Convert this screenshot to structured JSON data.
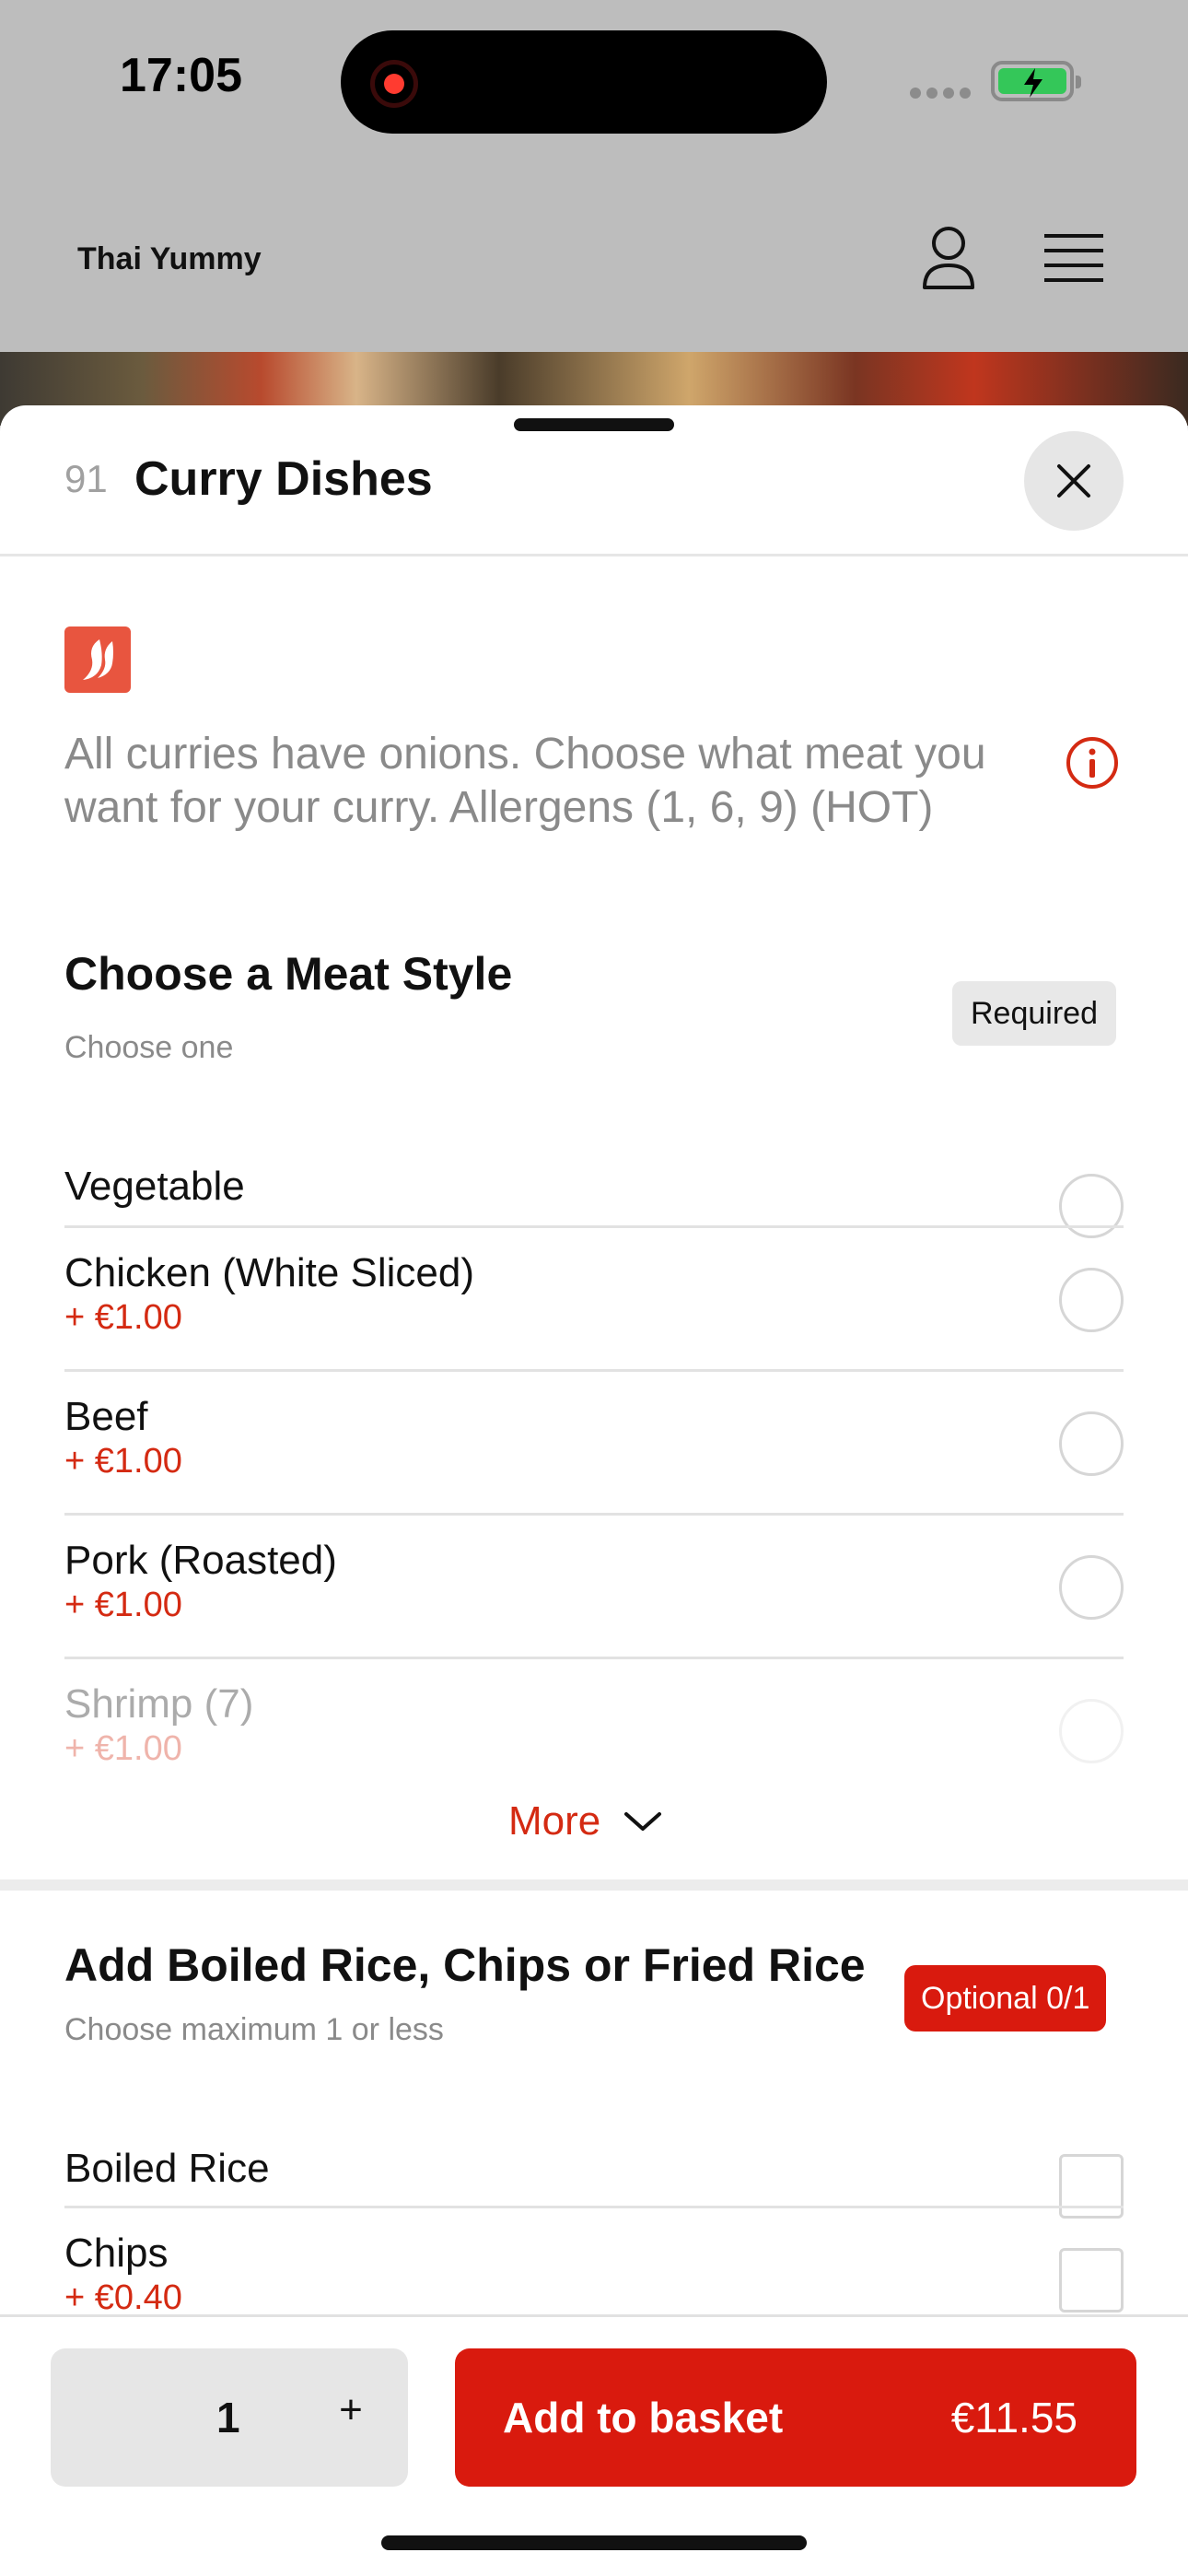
{
  "status_bar": {
    "time": "17:05"
  },
  "app": {
    "brand": "Thai Yummy"
  },
  "sheet": {
    "item_number": "91",
    "title": "Curry Dishes",
    "description": "All curries have onions. Choose what meat you want for your curry. Allergens (1, 6, 9) (HOT)"
  },
  "group1": {
    "title": "Choose a Meat Style",
    "subtitle": "Choose one",
    "badge": "Required",
    "options": [
      {
        "name": "Vegetable",
        "price": ""
      },
      {
        "name": "Chicken (White  Sliced)",
        "price": "+ €1.00"
      },
      {
        "name": "Beef",
        "price": "+ €1.00"
      },
      {
        "name": "Pork (Roasted)",
        "price": "+ €1.00"
      },
      {
        "name": "Shrimp (7)",
        "price": "+ €1.00"
      }
    ],
    "more_label": "More"
  },
  "group2": {
    "title": "Add Boiled Rice, Chips or Fried Rice",
    "subtitle": "Choose maximum 1 or less",
    "badge": "Optional 0/1",
    "options": [
      {
        "name": "Boiled Rice",
        "price": ""
      },
      {
        "name": "Chips",
        "price": "+ €0.40"
      }
    ]
  },
  "footer": {
    "quantity": "1",
    "plus_label": "+",
    "add_label": "Add to basket",
    "total": "€11.55"
  },
  "colors": {
    "accent": "#d91a0e",
    "price": "#d42a12",
    "muted": "#8a8a8a"
  },
  "icons": [
    "user-icon",
    "menu-icon",
    "close-icon",
    "chili-icon",
    "info-icon",
    "chevron-down-icon",
    "battery-icon"
  ]
}
